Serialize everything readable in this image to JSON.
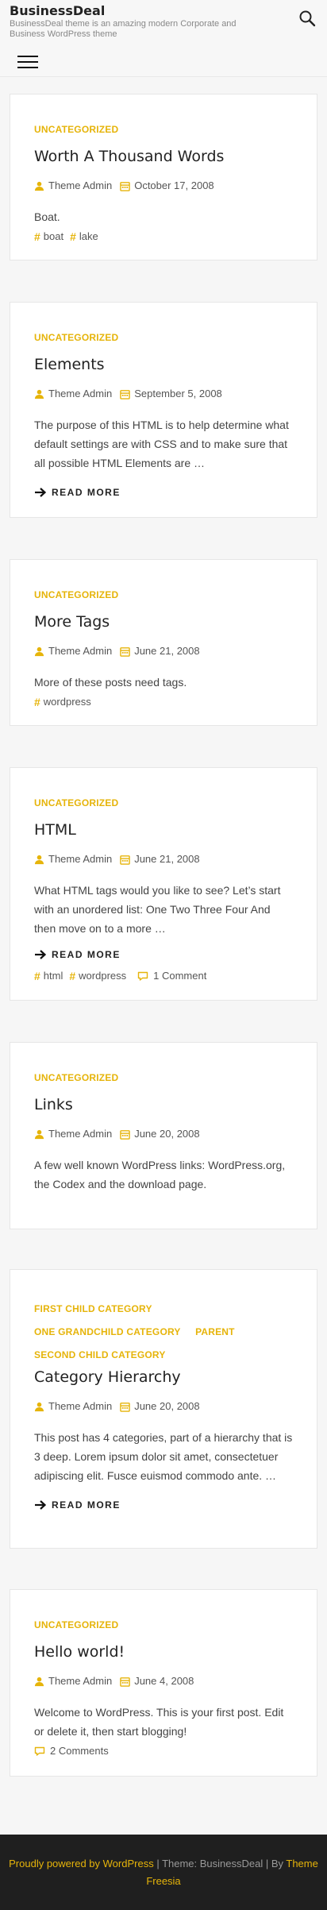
{
  "header": {
    "site_title": "BusinessDeal",
    "site_description": "BusinessDeal theme is an amazing modern Corporate and Business WordPress theme"
  },
  "posts": [
    {
      "categories": [
        "UNCATEGORIZED"
      ],
      "title": "Worth A Thousand Words",
      "author": "Theme Admin",
      "date": "October 17, 2008",
      "excerpt": "Boat.",
      "tags": [
        "boat",
        "lake"
      ]
    },
    {
      "categories": [
        "UNCATEGORIZED"
      ],
      "title": "Elements",
      "author": "Theme Admin",
      "date": "September 5, 2008",
      "excerpt": "The purpose of this HTML is to help determine what default settings are with CSS and to make sure that all possible HTML Elements are …",
      "read_more": "READ MORE"
    },
    {
      "categories": [
        "UNCATEGORIZED"
      ],
      "title": "More Tags",
      "author": "Theme Admin",
      "date": "June 21, 2008",
      "excerpt": "More of these posts need tags.",
      "tags": [
        "wordpress"
      ]
    },
    {
      "categories": [
        "UNCATEGORIZED"
      ],
      "title": "HTML",
      "author": "Theme Admin",
      "date": "June 21, 2008",
      "excerpt": "What HTML tags would you like to see? Let’s start with an unordered list: One Two Three Four And then move on to a more …",
      "read_more": "READ MORE",
      "tags": [
        "html",
        "wordpress"
      ],
      "comments": "1 Comment"
    },
    {
      "categories": [
        "UNCATEGORIZED"
      ],
      "title": "Links",
      "author": "Theme Admin",
      "date": "June 20, 2008",
      "excerpt": "A few well known WordPress links: WordPress.org, the Codex and the download page."
    },
    {
      "categories": [
        "FIRST CHILD CATEGORY",
        "ONE GRANDCHILD CATEGORY",
        "PARENT",
        "SECOND CHILD CATEGORY"
      ],
      "title": "Category Hierarchy",
      "author": "Theme Admin",
      "date": "June 20, 2008",
      "excerpt": "This post has 4 categories, part of a hierarchy that is 3 deep. Lorem ipsum dolor sit amet, consectetuer adipiscing elit. Fusce euismod commodo ante. …",
      "read_more": "READ MORE"
    },
    {
      "categories": [
        "UNCATEGORIZED"
      ],
      "title": "Hello world!",
      "author": "Theme Admin",
      "date": "June 4, 2008",
      "excerpt": "Welcome to WordPress. This is your first post. Edit or delete it, then start blogging!",
      "comments": "2 Comments"
    }
  ],
  "footer": {
    "powered_by": "Proudly powered by WordPress",
    "theme_text": " | Theme: BusinessDeal | By ",
    "theme_author": "Theme Freesia"
  },
  "icons": {
    "search": "search-icon",
    "menu": "hamburger-menu-icon",
    "author": "user-icon",
    "date": "calendar-icon",
    "read_more": "arrow-right-icon",
    "comments": "comment-icon",
    "tag": "hash-icon"
  },
  "colors": {
    "accent": "#e6b40a",
    "footer_bg": "#1f1f1f",
    "text": "#333333"
  }
}
